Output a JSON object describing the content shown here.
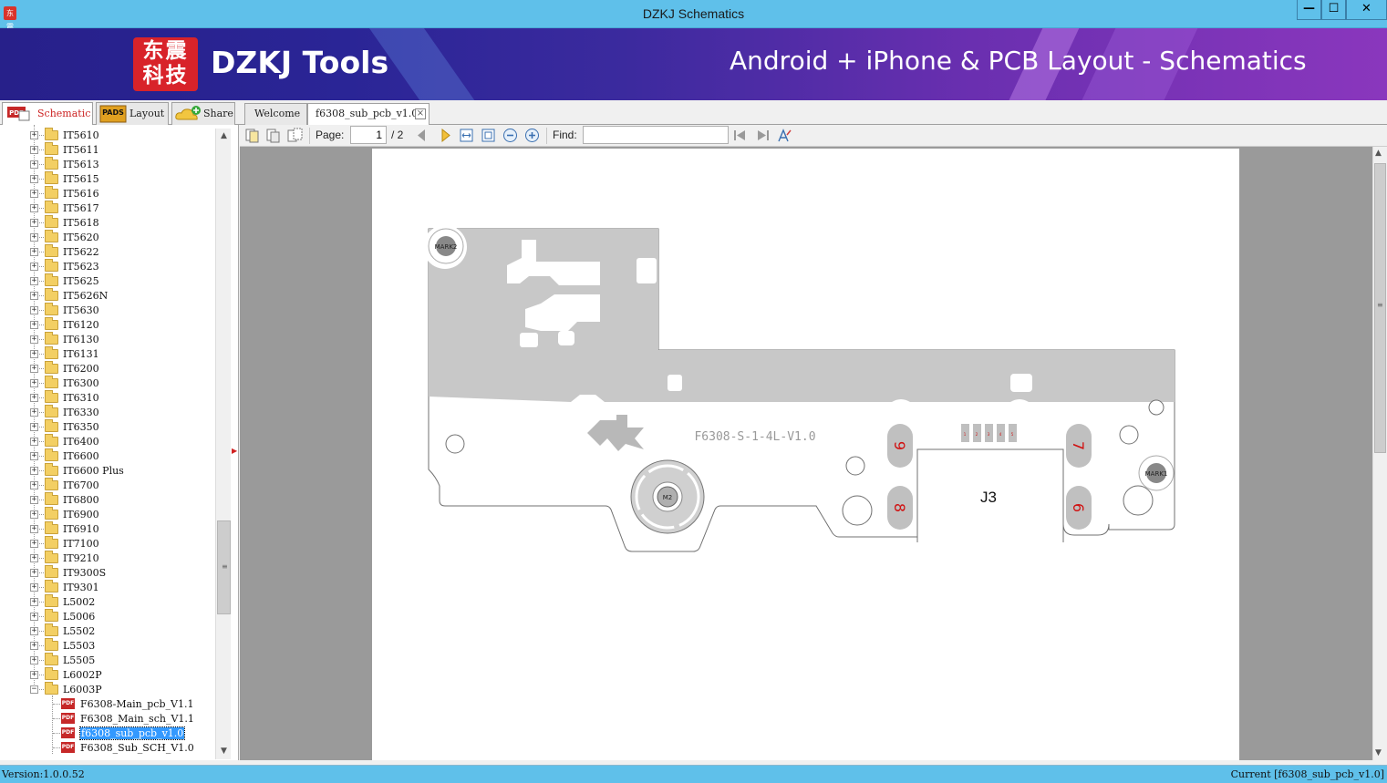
{
  "window": {
    "title": "DZKJ Schematics",
    "app_icon_text": "东震",
    "min_glyph": "—",
    "max_glyph": "☐",
    "close_glyph": "✕"
  },
  "banner": {
    "logo_text": "东震科技",
    "brand": "DZKJ Tools",
    "tagline": "Android + iPhone & PCB Layout - Schematics"
  },
  "nav_tabs": [
    {
      "label": "Schematic",
      "icon": "pdf-icon",
      "active": true
    },
    {
      "label": "Layout",
      "icon": "pads-icon",
      "active": false
    },
    {
      "label": "Share",
      "icon": "cloud-share-icon",
      "active": false
    }
  ],
  "nav_icon_text": {
    "pdf": "PDF",
    "pads": "PADS"
  },
  "doc_tabs": [
    {
      "label": "Welcome",
      "active": false
    },
    {
      "label": "f6308_sub_pcb_v1.0",
      "active": true,
      "close": "×"
    }
  ],
  "tree": {
    "folders": [
      "IT5610",
      "IT5611",
      "IT5613",
      "IT5615",
      "IT5616",
      "IT5617",
      "IT5618",
      "IT5620",
      "IT5622",
      "IT5623",
      "IT5625",
      "IT5626N",
      "IT5630",
      "IT6120",
      "IT6130",
      "IT6131",
      "IT6200",
      "IT6300",
      "IT6310",
      "IT6330",
      "IT6350",
      "IT6400",
      "IT6600",
      "IT6600 Plus",
      "IT6700",
      "IT6800",
      "IT6900",
      "IT6910",
      "IT7100",
      "IT9210",
      "IT9300S",
      "IT9301",
      "L5002",
      "L5006",
      "L5502",
      "L5503",
      "L5505",
      "L6002P",
      "L6003P"
    ],
    "expanded_folder": "L6003P",
    "files": [
      "F6308-Main_pcb_V1.1",
      "F6308_Main_sch_V1.1",
      "f6308_sub_pcb_v1.0",
      "F6308_Sub_SCH_V1.0"
    ],
    "selected_file": "f6308_sub_pcb_v1.0",
    "expand_glyph": "+",
    "collapse_glyph": "−",
    "pdf_badge": "PDF"
  },
  "toolbar": {
    "page_label": "Page:",
    "page_current": "1",
    "page_total": "/ 2",
    "find_label": "Find:",
    "find_value": ""
  },
  "pcb": {
    "board_label": "F6308-S-1-4L-V1.0",
    "connector_label": "J3",
    "fiducials": [
      "MARK2",
      "MARK1"
    ],
    "motor_label": "M2",
    "pad_labels": [
      "9",
      "8",
      "7",
      "6"
    ],
    "pin_labels": [
      "1",
      "2",
      "3",
      "4",
      "5"
    ],
    "copper_color": "#c8c8c8",
    "outline_color": "#707070",
    "pad_label_color": "#d01010"
  },
  "status": {
    "version": "Version:1.0.0.52",
    "current": "Current [f6308_sub_pcb_v1.0]"
  }
}
